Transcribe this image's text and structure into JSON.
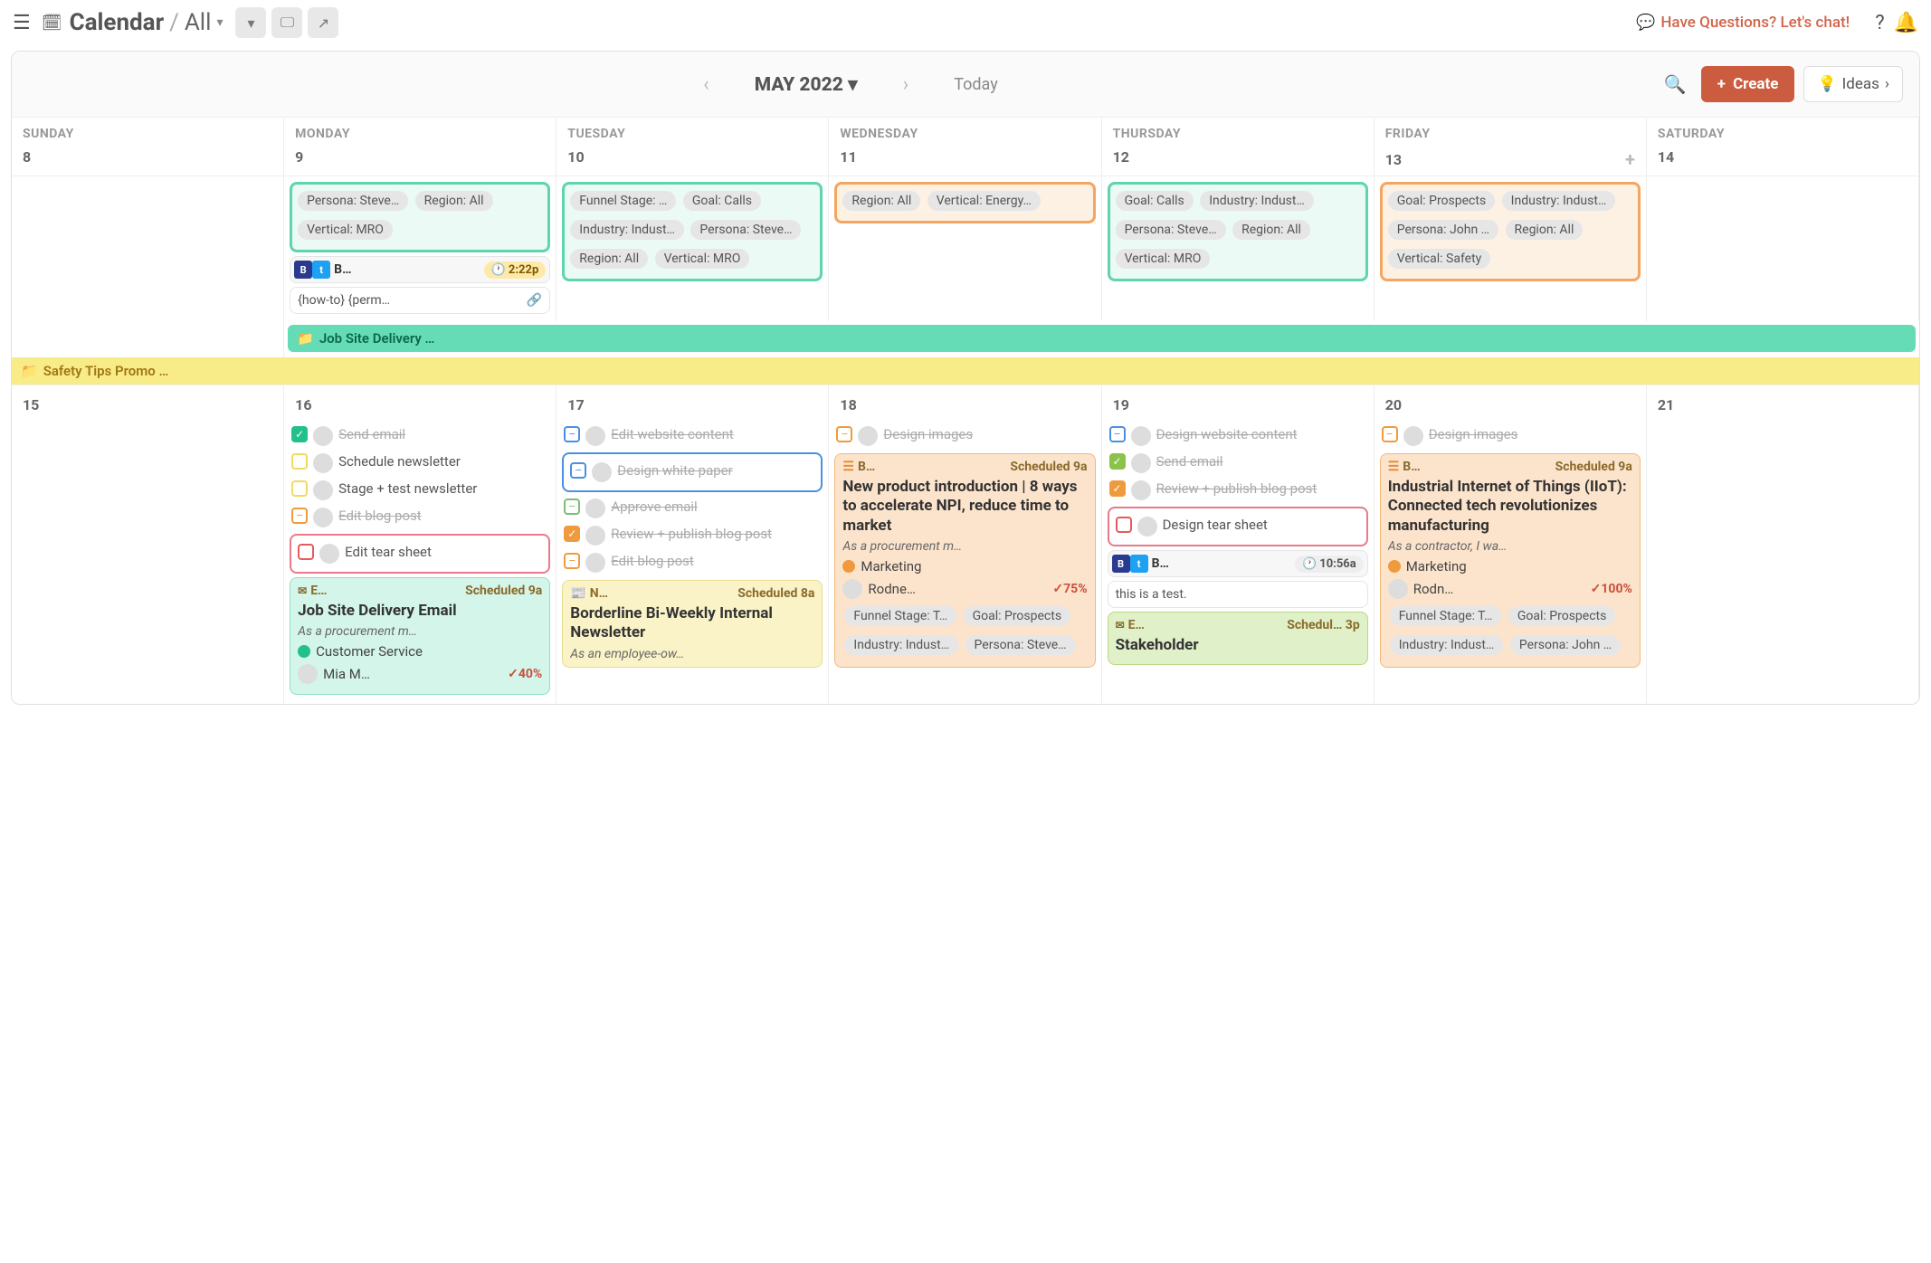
{
  "top": {
    "brand": "Calendar",
    "crumb": "All",
    "chat": "Have Questions? Let's chat!"
  },
  "header": {
    "month": "MAY 2022",
    "today": "Today",
    "create": "Create",
    "ideas": "Ideas"
  },
  "dayNames": [
    "SUNDAY",
    "MONDAY",
    "TUESDAY",
    "WEDNESDAY",
    "THURSDAY",
    "FRIDAY",
    "SATURDAY"
  ],
  "week1": {
    "nums": [
      "8",
      "9",
      "10",
      "11",
      "12",
      "13",
      "14"
    ],
    "mon": {
      "pills": [
        "Persona: Steve…",
        "Region: All",
        "Vertical: MRO"
      ],
      "social_label": "B…",
      "time": "2:22p",
      "perm": "{how-to} {perm…"
    },
    "tue": {
      "pills": [
        "Funnel Stage: …",
        "Goal: Calls",
        "Industry: Indust…",
        "Persona: Steve…",
        "Region: All",
        "Vertical: MRO"
      ]
    },
    "wed": {
      "pills": [
        "Region: All",
        "Vertical: Energy…"
      ]
    },
    "thu": {
      "pills": [
        "Goal: Calls",
        "Industry: Indust…",
        "Persona: Steve…",
        "Region: All",
        "Vertical: MRO"
      ]
    },
    "fri": {
      "pills": [
        "Goal: Prospects",
        "Industry: Indust…",
        "Persona: John …",
        "Region: All",
        "Vertical: Safety"
      ]
    }
  },
  "banners": {
    "teal": "Job Site Delivery …",
    "yellow": "Safety Tips Promo …"
  },
  "week2": {
    "nums": [
      "15",
      "16",
      "17",
      "18",
      "19",
      "20",
      "21"
    ],
    "d16": {
      "t1": "Send email",
      "t2": "Schedule newsletter",
      "t3": "Stage + test newsletter",
      "t4": "Edit blog post",
      "t5": "Edit tear sheet",
      "ev_label": "E…",
      "ev_sched": "Scheduled 9a",
      "ev_title": "Job Site Delivery Email",
      "ev_desc": "As a procurement m…",
      "ev_cat": "Customer Service",
      "ev_owner": "Mia M…",
      "ev_pct": "40%"
    },
    "d17": {
      "t1": "Edit website content",
      "t2": "Design white paper",
      "t3": "Approve email",
      "t4": "Review + publish blog post",
      "t5": "Edit blog post",
      "ev_label": "N…",
      "ev_sched": "Scheduled 8a",
      "ev_title": "Borderline Bi-Weekly Internal Newsletter",
      "ev_desc": "As an employee-ow…"
    },
    "d18": {
      "t1": "Design images",
      "ev_label": "B…",
      "ev_sched": "Scheduled 9a",
      "ev_title": "New product introduction | 8 ways to accelerate NPI, reduce time to market",
      "ev_desc": "As a procurement m…",
      "ev_cat": "Marketing",
      "ev_owner": "Rodne…",
      "ev_pct": "75%",
      "pills": [
        "Funnel Stage: T…",
        "Goal: Prospects",
        "Industry: Indust…",
        "Persona: Steve…"
      ]
    },
    "d19": {
      "t1": "Design website content",
      "t2": "Send email",
      "t3": "Review + publish blog post",
      "t4": "Design tear sheet",
      "social_label": "B…",
      "time": "10:56a",
      "test": "this is a test.",
      "ev_label": "E…",
      "ev_sched": "Schedul…  3p",
      "ev_title": "Stakeholder"
    },
    "d20": {
      "t1": "Design images",
      "ev_label": "B…",
      "ev_sched": "Scheduled 9a",
      "ev_title": "Industrial Internet of Things (IIoT): Connected tech revolutionizes manufacturing",
      "ev_desc": "As a contractor, I wa…",
      "ev_cat": "Marketing",
      "ev_owner": "Rodn…",
      "ev_pct": "100%",
      "pills": [
        "Funnel Stage: T…",
        "Goal: Prospects",
        "Industry: Indust…",
        "Persona: John …"
      ]
    }
  }
}
